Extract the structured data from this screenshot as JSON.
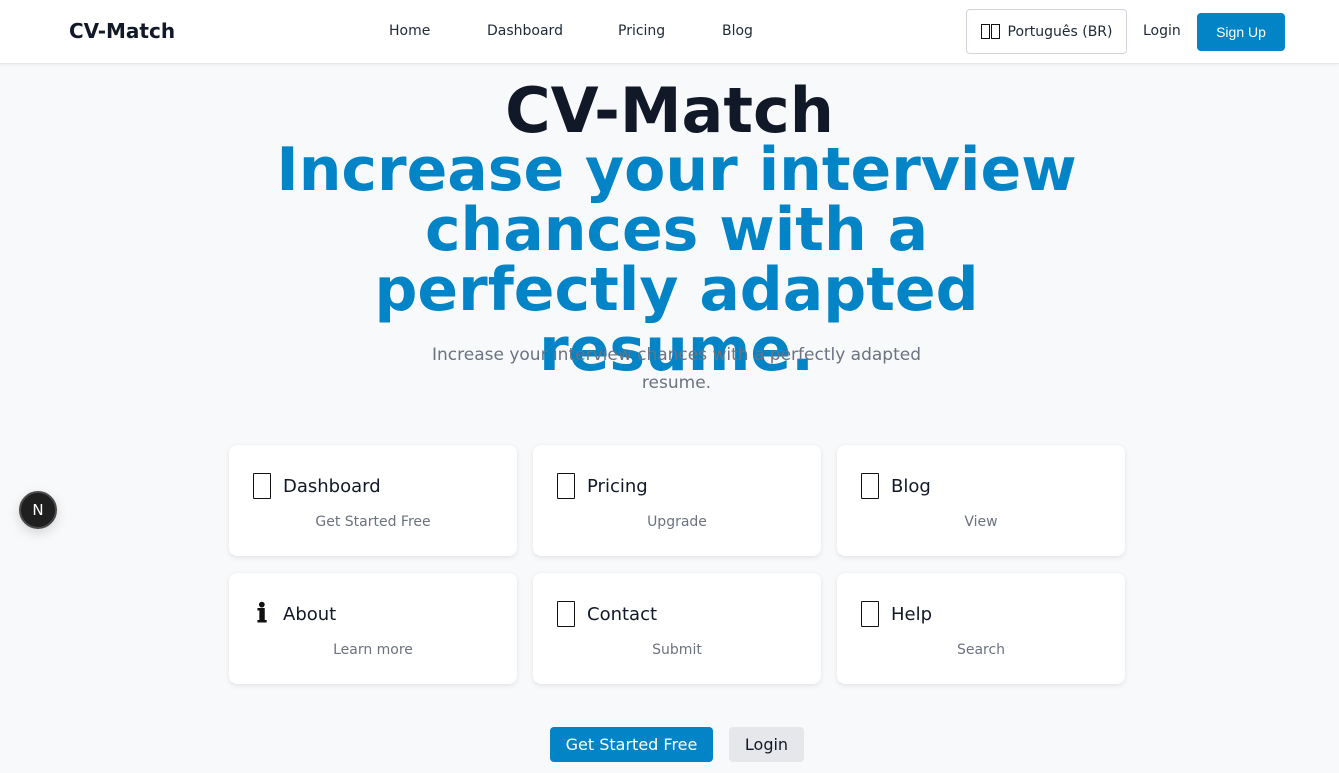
{
  "header": {
    "brand": "CV-Match",
    "nav": [
      "Home",
      "Dashboard",
      "Pricing",
      "Blog"
    ],
    "language": "Português (BR)",
    "login": "Login",
    "signup": "Sign Up"
  },
  "hero": {
    "title": "CV-Match",
    "tagline": "Increase your interview chances with a perfectly adapted resume.",
    "subtitle": "Increase your interview chances with a perfectly adapted resume."
  },
  "cards": [
    {
      "title": "Dashboard",
      "action": "Get Started Free",
      "icon": "box-icon"
    },
    {
      "title": "Pricing",
      "action": "Upgrade",
      "icon": "box-icon"
    },
    {
      "title": "Blog",
      "action": "View",
      "icon": "box-icon"
    },
    {
      "title": "About",
      "action": "Learn more",
      "icon": "info-icon",
      "glyph": "ℹ"
    },
    {
      "title": "Contact",
      "action": "Submit",
      "icon": "box-icon"
    },
    {
      "title": "Help",
      "action": "Search",
      "icon": "box-icon"
    }
  ],
  "cta": {
    "primary": "Get Started Free",
    "secondary": "Login"
  },
  "dev_badge": "N",
  "colors": {
    "accent": "#0284c7",
    "background": "#f8f9fb",
    "text": "#111827",
    "muted": "#6b7280"
  }
}
